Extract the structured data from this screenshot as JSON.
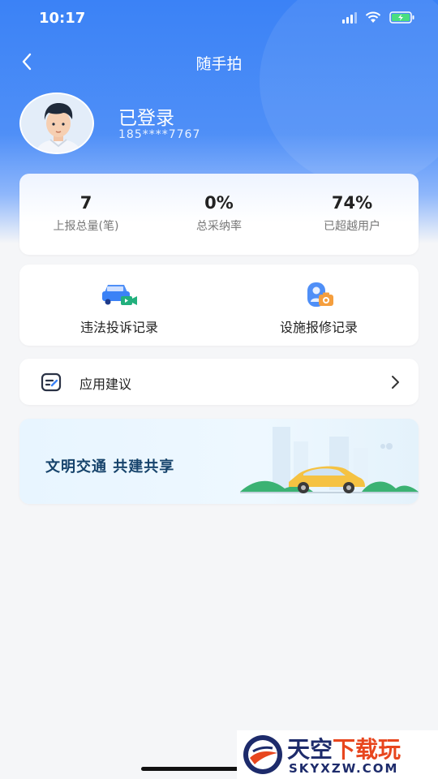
{
  "status": {
    "time": "10:17"
  },
  "nav": {
    "title": "随手拍"
  },
  "profile": {
    "name": "已登录",
    "phone": "185****7767"
  },
  "stats": [
    {
      "value": "7",
      "label": "上报总量(笔)"
    },
    {
      "value": "0%",
      "label": "总采纳率"
    },
    {
      "value": "74%",
      "label": "已超越用户"
    }
  ],
  "records": [
    {
      "label": "违法投诉记录",
      "icon": "car-video-icon"
    },
    {
      "label": "设施报修记录",
      "icon": "person-camera-icon"
    }
  ],
  "suggest": {
    "label": "应用建议",
    "icon": "edit-note-icon"
  },
  "banner": {
    "text": "文明交通  共建共享"
  },
  "watermark": {
    "title_a": "天空",
    "title_b": "下载玩",
    "sub": "SKYXZW.COM"
  },
  "colors": {
    "accent": "#3b82f6",
    "banner_text": "#16436b",
    "car": "#f5c242"
  }
}
